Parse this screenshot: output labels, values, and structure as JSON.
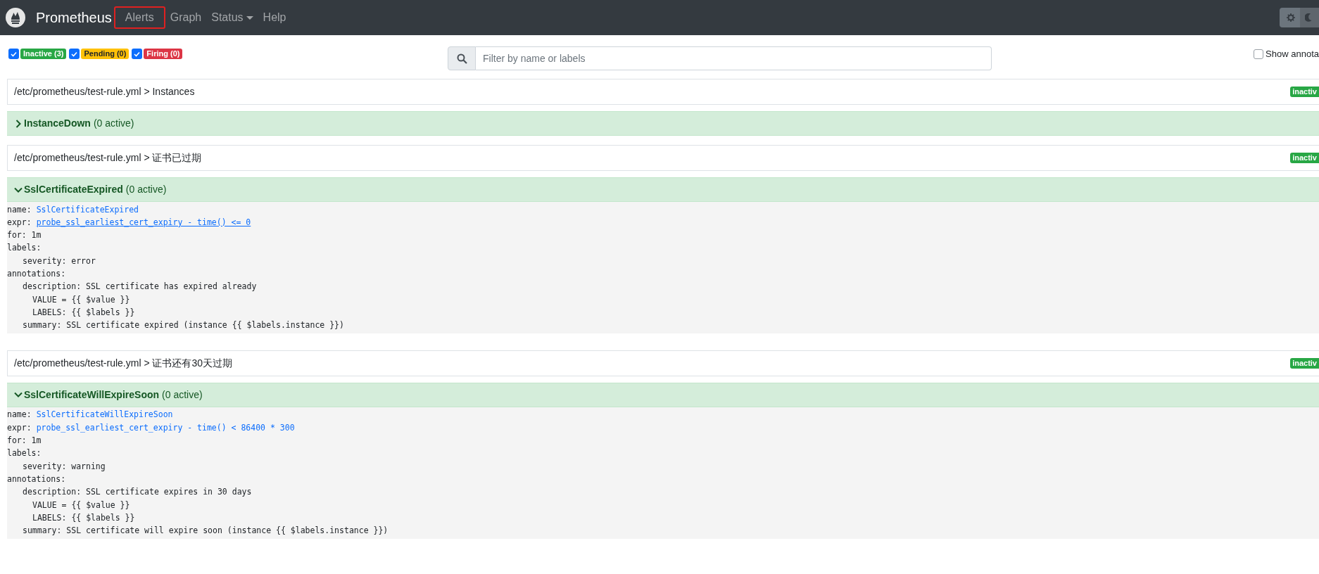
{
  "navbar": {
    "brand": "Prometheus",
    "links": [
      {
        "label": "Alerts",
        "kind": "link",
        "highlighted": true
      },
      {
        "label": "Graph",
        "kind": "link",
        "highlighted": false
      },
      {
        "label": "Status",
        "kind": "dropdown",
        "highlighted": false
      },
      {
        "label": "Help",
        "kind": "link",
        "highlighted": false
      }
    ]
  },
  "theme": [
    {
      "kind": "light",
      "selected": true
    },
    {
      "kind": "dark",
      "selected": false
    }
  ],
  "filters": [
    {
      "label": "Inactive (3)",
      "checked": true,
      "color": "#28a745"
    },
    {
      "label": "Pending (0)",
      "checked": true,
      "color": "#ffc107"
    },
    {
      "label": "Firing (0)",
      "checked": true,
      "color": "#dc3545"
    }
  ],
  "search": {
    "placeholder": "Filter by name or labels"
  },
  "show_annotations": {
    "label": "Show annota",
    "checked": false
  },
  "groups": [
    {
      "title": "/etc/prometheus/test-rule.yml > Instances",
      "badge": "inactiv",
      "rule": {
        "name": "InstanceDown",
        "count": "(0 active)",
        "expanded": false
      }
    },
    {
      "title": "/etc/prometheus/test-rule.yml > 证书已过期",
      "badge": "inactiv",
      "rule": {
        "name": "SslCertificateExpired",
        "count": "(0 active)",
        "expanded": true,
        "lines": [
          {
            "text": "name:",
            "link": "SslCertificateExpired",
            "hovered": false
          },
          {
            "text": "expr:",
            "link": "probe_ssl_earliest_cert_expiry - time() <= 0",
            "hovered": true
          },
          {
            "text": "for: 1m"
          },
          {
            "text": "labels:",
            "children": [
              {
                "text": "severity: error"
              }
            ]
          },
          {
            "text": "annotations:",
            "children": [
              {
                "text": "description: SSL certificate has expired already",
                "children": [
                  {
                    "text": "VALUE = {{ $value }}"
                  },
                  {
                    "text": "LABELS: {{ $labels }}"
                  }
                ]
              },
              {
                "text": "summary: SSL certificate expired (instance {{ $labels.instance }})"
              }
            ]
          }
        ]
      }
    },
    {
      "title": "/etc/prometheus/test-rule.yml > 证书还有30天过期",
      "badge": "inactiv",
      "rule": {
        "name": "SslCertificateWillExpireSoon",
        "count": "(0 active)",
        "expanded": true,
        "lines": [
          {
            "text": "name:",
            "link": "SslCertificateWillExpireSoon",
            "hovered": false
          },
          {
            "text": "expr:",
            "link": "probe_ssl_earliest_cert_expiry - time() < 86400 * 300",
            "hovered": false
          },
          {
            "text": "for: 1m"
          },
          {
            "text": "labels:",
            "children": [
              {
                "text": "severity: warning"
              }
            ]
          },
          {
            "text": "annotations:",
            "children": [
              {
                "text": "description: SSL certificate expires in 30 days",
                "children": [
                  {
                    "text": "VALUE = {{ $value }}"
                  },
                  {
                    "text": "LABELS: {{ $labels }}"
                  }
                ]
              },
              {
                "text": "summary: SSL certificate will expire soon (instance {{ $labels.instance }})"
              }
            ]
          }
        ]
      }
    }
  ]
}
